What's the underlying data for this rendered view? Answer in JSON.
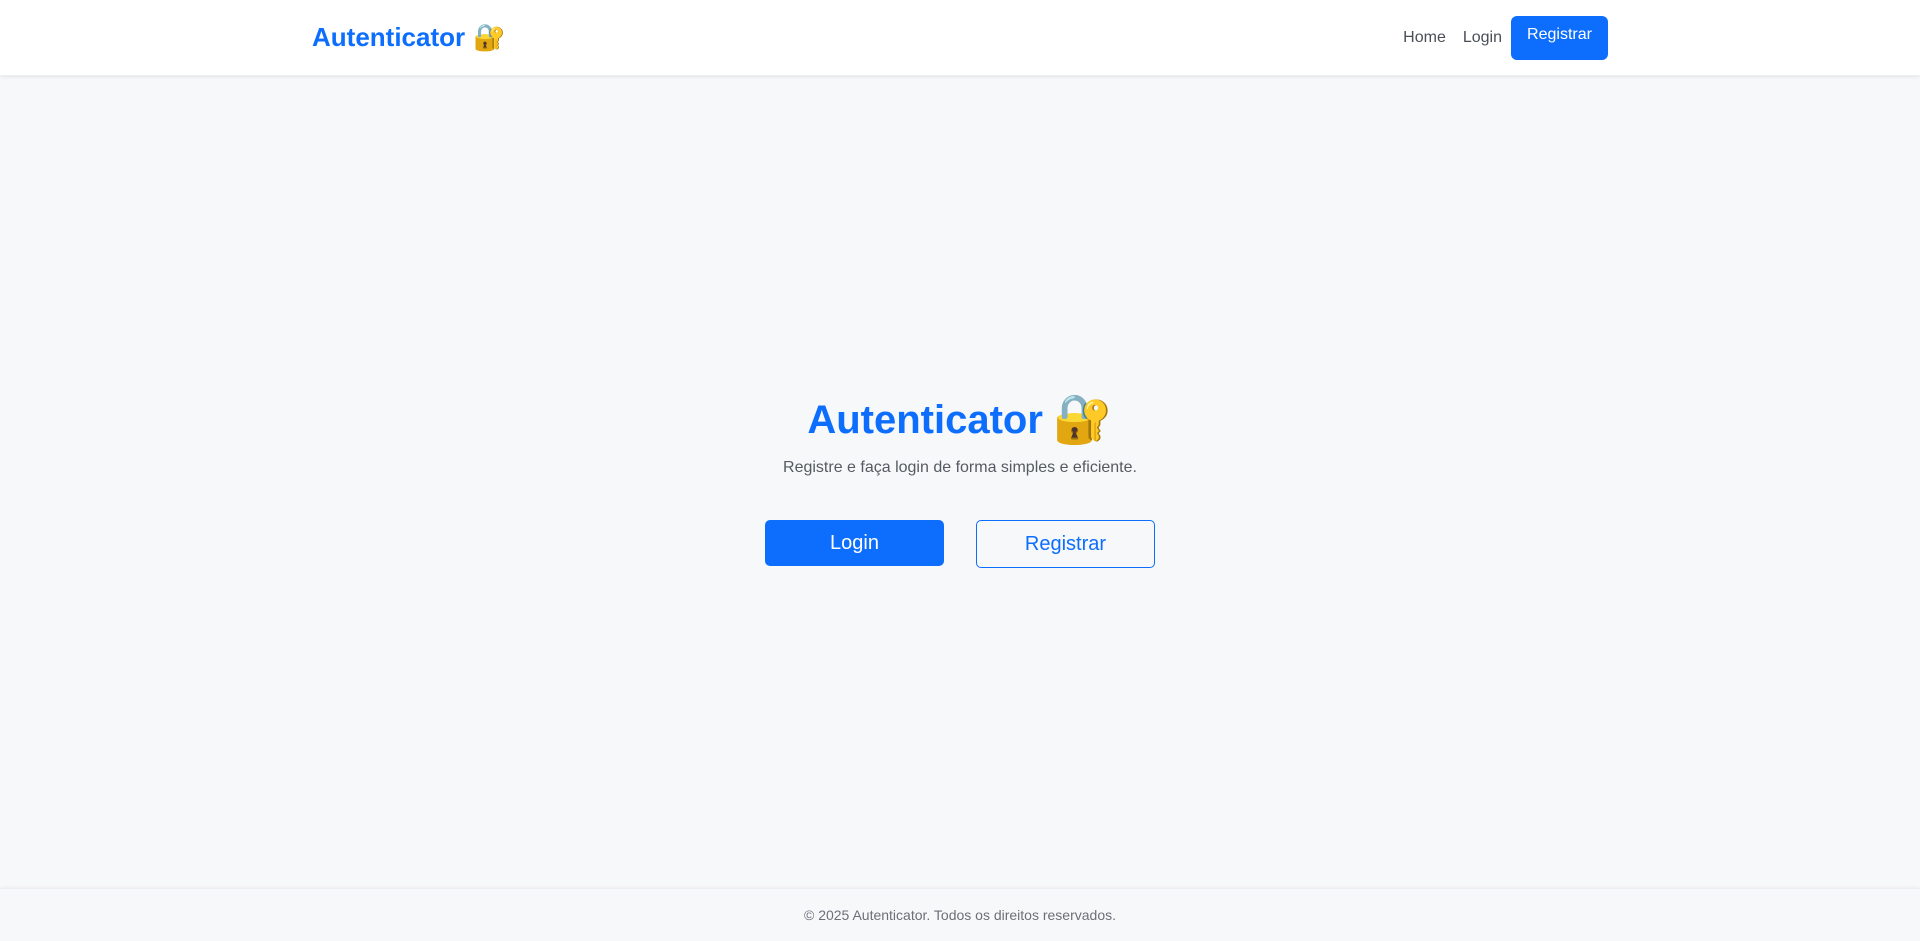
{
  "navbar": {
    "brand": "Autenticator",
    "brand_icon": "🔐",
    "links": {
      "home": "Home",
      "login": "Login",
      "register": "Registrar"
    }
  },
  "hero": {
    "title": "Autenticator",
    "title_icon": "🔐",
    "subtitle": "Registre e faça login de forma simples e eficiente.",
    "login_button": "Login",
    "register_button": "Registrar"
  },
  "footer": {
    "text": "© 2025 Autenticator. Todos os direitos reservados."
  },
  "colors": {
    "accent": "#0d6efd",
    "background": "#f7f8fa"
  }
}
